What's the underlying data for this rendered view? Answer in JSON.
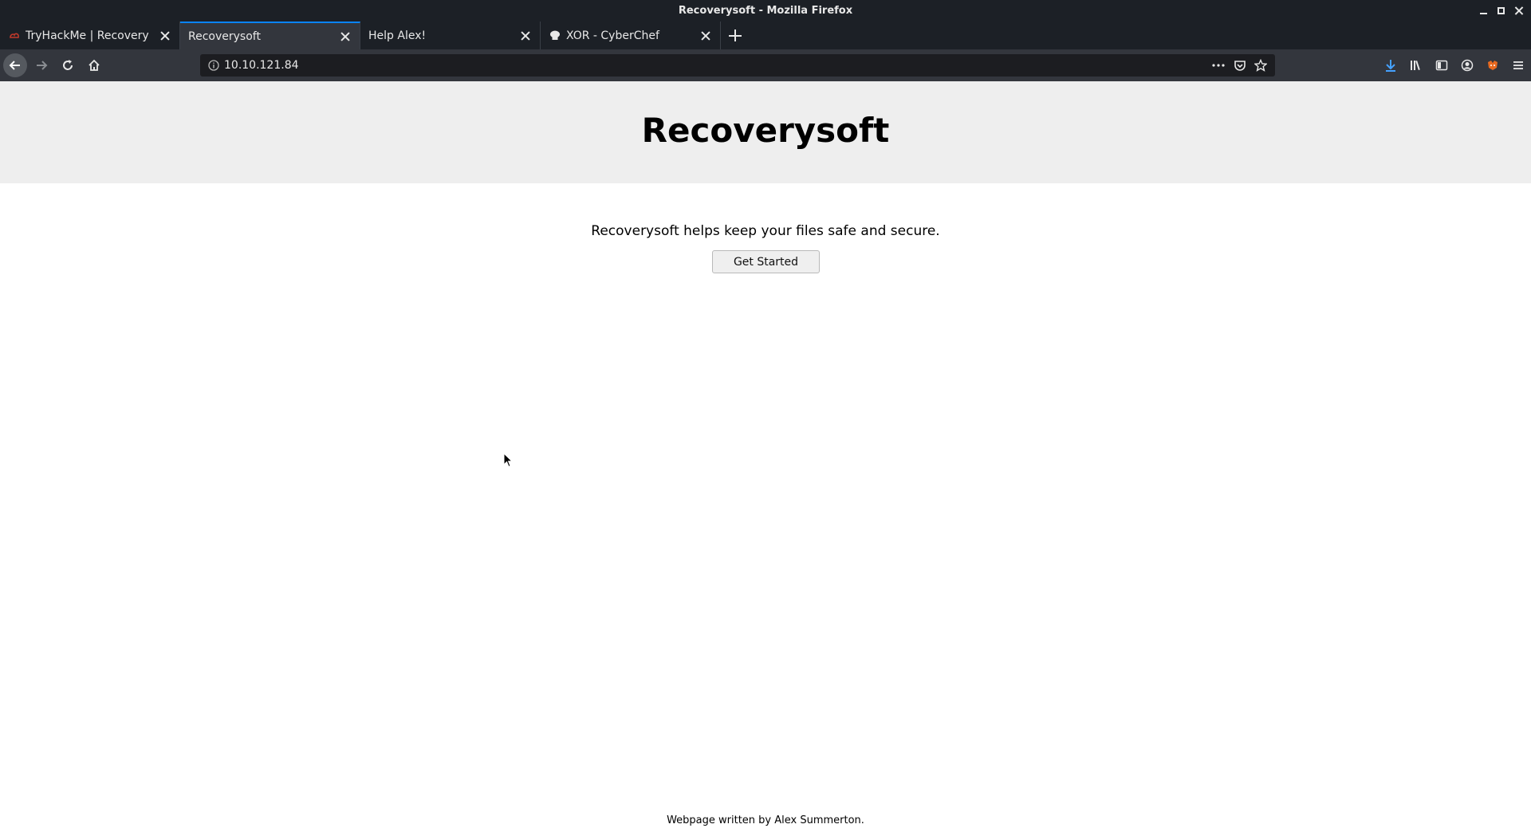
{
  "window": {
    "title": "Recoverysoft - Mozilla Firefox"
  },
  "tabs": [
    {
      "label": "TryHackMe | Recovery",
      "icon": "tryhackme-icon",
      "active": false
    },
    {
      "label": "Recoverysoft",
      "icon": "",
      "active": true
    },
    {
      "label": "Help Alex!",
      "icon": "",
      "active": false
    },
    {
      "label": "XOR - CyberChef",
      "icon": "cyberchef-icon",
      "active": false
    }
  ],
  "navbar": {
    "url": "10.10.121.84"
  },
  "page": {
    "heading": "Recoverysoft",
    "tagline": "Recoverysoft helps keep your files safe and secure.",
    "cta_label": "Get Started",
    "footer": "Webpage written by Alex Summerton."
  },
  "colors": {
    "chrome_dark": "#1c2026",
    "toolbar": "#33363d",
    "accent": "#0a84ff",
    "hero_bg": "#eeeeee"
  }
}
